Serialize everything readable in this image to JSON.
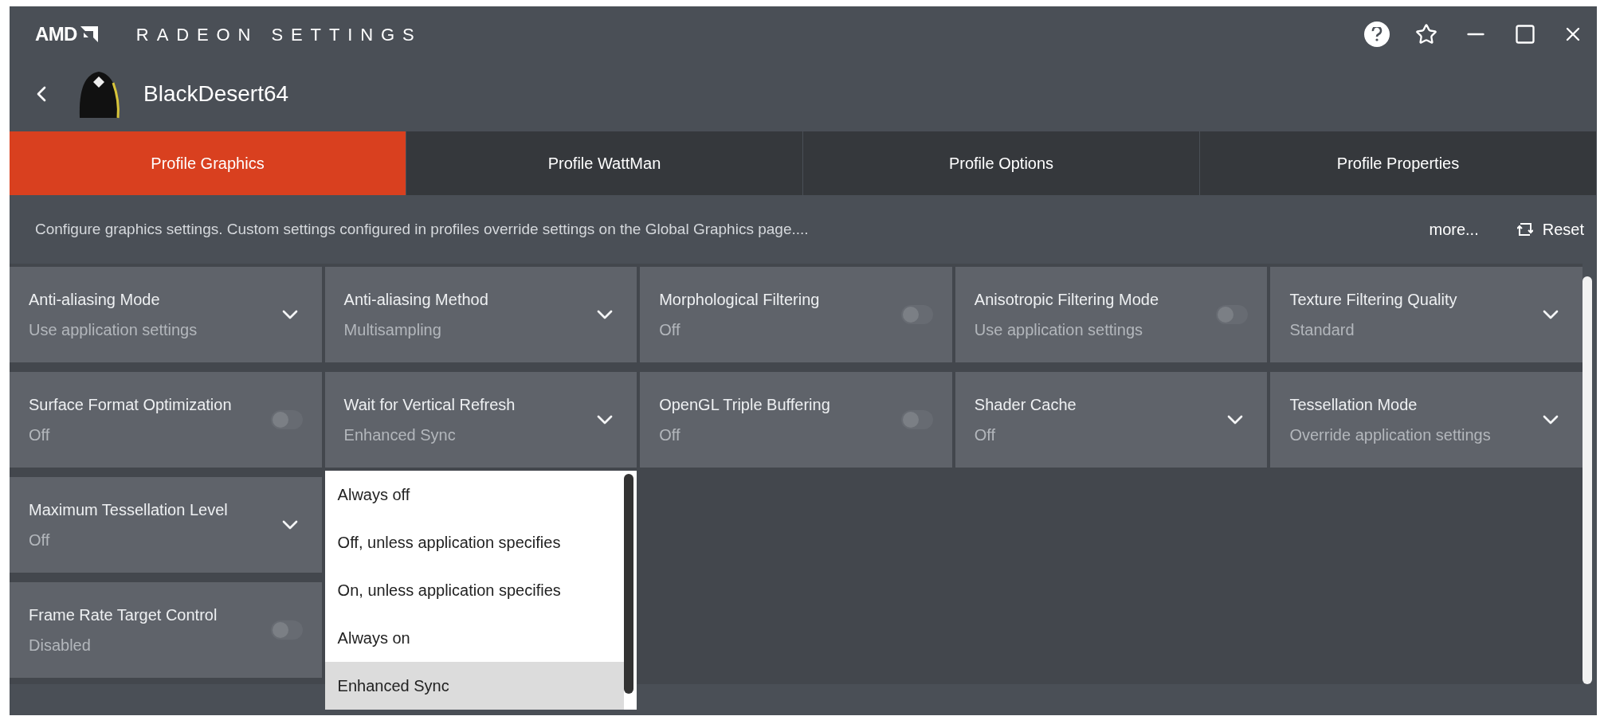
{
  "app": {
    "logo": "AMD",
    "title": "RADEON SETTINGS"
  },
  "profile": {
    "name": "BlackDesert64"
  },
  "tabs": [
    {
      "label": "Profile Graphics",
      "selected": true
    },
    {
      "label": "Profile WattMan",
      "selected": false
    },
    {
      "label": "Profile Options",
      "selected": false
    },
    {
      "label": "Profile Properties",
      "selected": false
    }
  ],
  "description": "Configure graphics settings. Custom settings configured in profiles override settings on the Global Graphics page....",
  "more_link": "more...",
  "reset_button": "Reset",
  "settings": [
    {
      "kind": "dropdown",
      "title": "Anti-aliasing Mode",
      "value": "Use application settings"
    },
    {
      "kind": "dropdown",
      "title": "Anti-aliasing Method",
      "value": "Multisampling"
    },
    {
      "kind": "toggle",
      "title": "Morphological Filtering",
      "value": "Off",
      "on": false
    },
    {
      "kind": "toggle",
      "title": "Anisotropic Filtering Mode",
      "value": "Use application settings",
      "on": false
    },
    {
      "kind": "dropdown",
      "title": "Texture Filtering Quality",
      "value": "Standard"
    },
    {
      "kind": "toggle",
      "title": "Surface Format Optimization",
      "value": "Off",
      "on": false
    },
    {
      "kind": "dropdown",
      "title": "Wait for Vertical Refresh",
      "value": "Enhanced Sync",
      "expanded": true,
      "options": [
        {
          "label": "Always off",
          "selected": false
        },
        {
          "label": "Off, unless application specifies",
          "selected": false
        },
        {
          "label": "On, unless application specifies",
          "selected": false
        },
        {
          "label": "Always on",
          "selected": false
        },
        {
          "label": "Enhanced Sync",
          "selected": true
        }
      ]
    },
    {
      "kind": "toggle",
      "title": "OpenGL Triple Buffering",
      "value": "Off",
      "on": false
    },
    {
      "kind": "dropdown",
      "title": "Shader Cache",
      "value": "Off"
    },
    {
      "kind": "dropdown",
      "title": "Tessellation Mode",
      "value": "Override application settings"
    },
    {
      "kind": "dropdown",
      "title": "Maximum Tessellation Level",
      "value": "Off"
    },
    {
      "kind": "toggle",
      "title": "Frame Rate Target Control",
      "value": "Disabled",
      "on": false
    }
  ]
}
